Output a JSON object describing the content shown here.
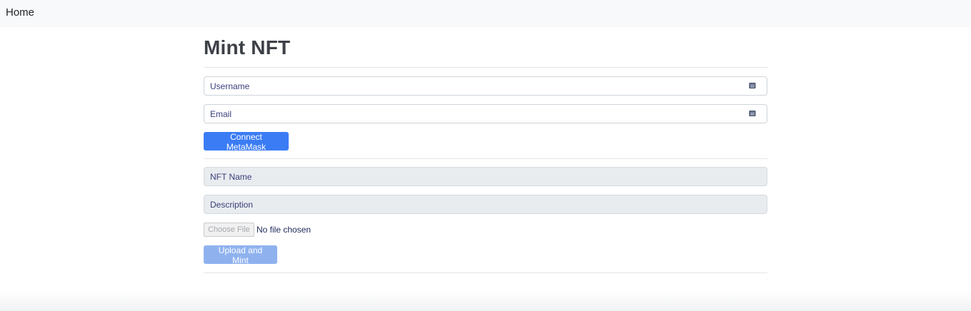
{
  "navbar": {
    "brand": "Home"
  },
  "page": {
    "title": "Mint NFT"
  },
  "account_form": {
    "username_placeholder": "Username",
    "email_placeholder": "Email",
    "field_icon": "keyboard-icon",
    "connect_button": "Connect MetaMask"
  },
  "mint_form": {
    "nft_name_placeholder": "NFT Name",
    "description_placeholder": "Description",
    "choose_file_button": "Choose File",
    "file_status": "No file chosen",
    "upload_button": "Upload and Mint",
    "upload_disabled": true
  },
  "colors": {
    "primary": "#3b7cf5",
    "primary_disabled": "#8fb2ef",
    "navbar_bg": "#f8f9fa",
    "disabled_field_bg": "#e9ecef"
  }
}
